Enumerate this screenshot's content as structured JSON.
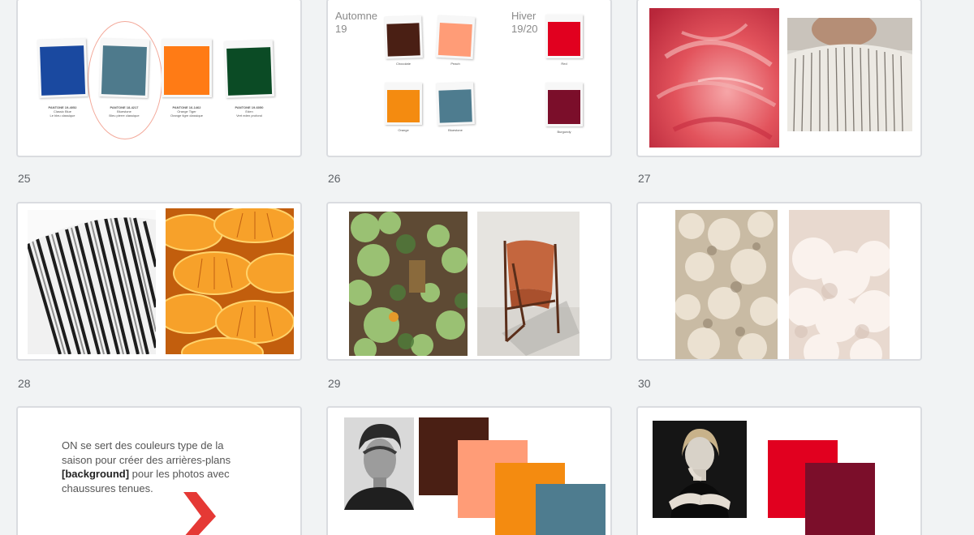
{
  "slides": [
    {
      "number": "25",
      "swatches": [
        {
          "color": "#1a49a0",
          "code": "PANTONE 19-4052",
          "name": "Classic Blue",
          "desc": "Le bleu classique"
        },
        {
          "color": "#4e7a8c",
          "code": "PANTONE 18-4217",
          "name": "Bluestone",
          "desc": "Bleu pierre classique"
        },
        {
          "color": "#ff7b15",
          "code": "PANTONE 16-1462",
          "name": "Orange Tiger",
          "desc": "Orange tigre classique"
        },
        {
          "color": "#0b4b25",
          "code": "PANTONE 19-6050",
          "name": "Eden",
          "desc": "Vert eden profond"
        }
      ]
    },
    {
      "number": "26",
      "season_autumn": "Automne",
      "season_autumn_year": "19",
      "season_winter": "Hiver",
      "season_winter_year": "19/20",
      "swatches_autumn": [
        {
          "color": "#4a1f14",
          "label": "Chocolate"
        },
        {
          "color": "#ff9c77",
          "label": "Peach"
        },
        {
          "color": "#f48b10",
          "label": "Orange"
        },
        {
          "color": "#4e7c8f",
          "label": "Bluestone"
        }
      ],
      "swatches_winter": [
        {
          "color": "#e1001f",
          "label": "Red"
        },
        {
          "color": "#7b0e2a",
          "label": "Burgundy"
        }
      ]
    },
    {
      "number": "27"
    },
    {
      "number": "28"
    },
    {
      "number": "29"
    },
    {
      "number": "30"
    },
    {
      "number": "",
      "text_line1": "ON se sert des couleurs type de la",
      "text_line2": "saison pour créer des arrières-plans",
      "text_bold": "[background]",
      "text_line3": " pour les photos avec",
      "text_line4": "chaussures tenues.",
      "arrow_color": "#e53935"
    },
    {
      "number": "",
      "blocks": [
        "#4a1f14",
        "#ff9c77",
        "#f48b10",
        "#4e7c8f"
      ]
    },
    {
      "number": "",
      "blocks": [
        "#e1001f",
        "#7b0e2a"
      ]
    }
  ]
}
